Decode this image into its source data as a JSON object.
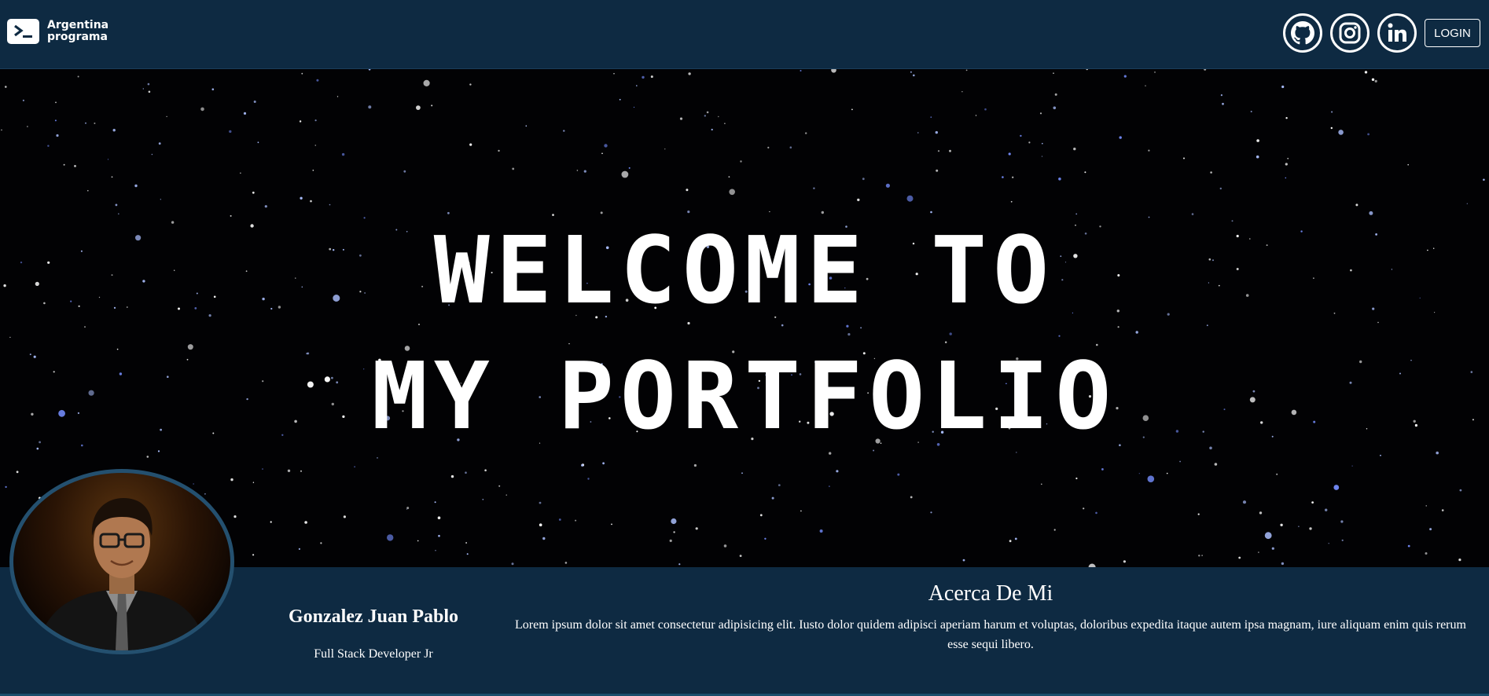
{
  "navbar": {
    "brand": {
      "line1": "Argentina",
      "line2": "programa",
      "icon": "terminal-icon"
    },
    "social": [
      {
        "name": "GitHub",
        "icon": "github-icon"
      },
      {
        "name": "Instagram",
        "icon": "instagram-icon"
      },
      {
        "name": "LinkedIn",
        "icon": "linkedin-icon"
      }
    ],
    "login_label": "LOGIN"
  },
  "hero": {
    "title": "WELCOME TO\nMY PORTFOLIO"
  },
  "profile": {
    "name": "Gonzalez Juan Pablo",
    "role": "Full Stack Developer Jr",
    "about_title": "Acerca De Mi",
    "about_text": "Lorem ipsum dolor sit amet consectetur adipisicing elit. Iusto dolor quidem adipisci aperiam harum et voluptas, doloribus expedita itaque autem ipsa magnam, iure aliquam enim quis rerum esse sequi libero."
  },
  "colors": {
    "navbar_bg": "#0e2a42",
    "hero_bg": "#020204",
    "avatar_border": "#24506f",
    "text": "#ffffff"
  }
}
